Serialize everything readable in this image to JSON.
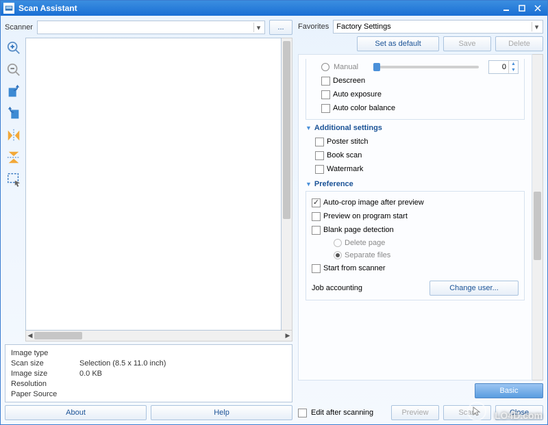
{
  "titlebar": {
    "title": "Scan Assistant"
  },
  "scanner": {
    "label": "Scanner",
    "value": "",
    "browse": "..."
  },
  "favorites": {
    "label": "Favorites",
    "value": "Factory Settings"
  },
  "fav_buttons": {
    "set_default": "Set as default",
    "save": "Save",
    "delete": "Delete"
  },
  "manual": {
    "label": "Manual",
    "value": "0"
  },
  "image_opts": {
    "descreen": "Descreen",
    "auto_exposure": "Auto exposure",
    "auto_color": "Auto color balance"
  },
  "additional": {
    "header": "Additional settings",
    "poster": "Poster stitch",
    "book": "Book scan",
    "watermark": "Watermark"
  },
  "preference": {
    "header": "Preference",
    "autocrop": "Auto-crop image after preview",
    "preview_start": "Preview on program start",
    "blank": "Blank page detection",
    "delete_page": "Delete page",
    "separate": "Separate files",
    "start_scanner": "Start from scanner",
    "job_acc": "Job accounting",
    "change_user": "Change user..."
  },
  "info": {
    "image_type_k": "Image type",
    "image_type_v": "",
    "scan_size_k": "Scan size",
    "scan_size_v": "Selection (8.5 x 11.0 inch)",
    "image_size_k": "Image size",
    "image_size_v": "0.0 KB",
    "resolution_k": "Resolution",
    "resolution_v": "",
    "paper_src_k": "Paper Source",
    "paper_src_v": ""
  },
  "bottom_left": {
    "about": "About",
    "help": "Help"
  },
  "footer": {
    "edit_after": "Edit after scanning",
    "basic": "Basic",
    "preview": "Preview",
    "scan": "Scan",
    "close": "Close"
  },
  "watermark": "LO4D.com"
}
